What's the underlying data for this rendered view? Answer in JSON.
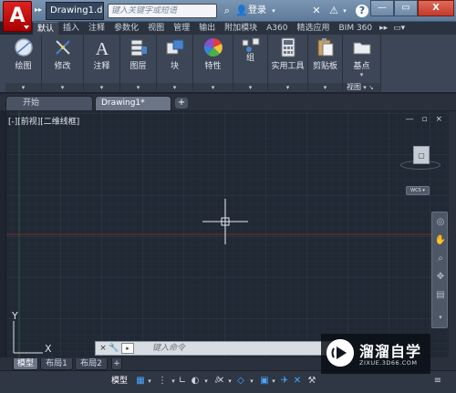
{
  "titlebar": {
    "logo_letter": "A",
    "doc_title": "Drawing1.d...",
    "search_placeholder": "键入关键字或短语",
    "login": "登录",
    "help": "?",
    "minimize": "—",
    "maximize": "▭",
    "close": "X"
  },
  "ribbon_tabs": [
    "默认",
    "插入",
    "注释",
    "参数化",
    "视图",
    "管理",
    "输出",
    "附加模块",
    "A360",
    "精选应用",
    "BIM 360"
  ],
  "ribbon_panels": [
    {
      "label": "绘图",
      "icon": "draw-icon"
    },
    {
      "label": "修改",
      "icon": "modify-icon"
    },
    {
      "label": "注释",
      "icon": "annotation-icon"
    },
    {
      "label": "图层",
      "icon": "layers-icon"
    },
    {
      "label": "块",
      "icon": "block-icon"
    },
    {
      "label": "特性",
      "icon": "properties-icon"
    },
    {
      "label": "组",
      "icon": "group-icon"
    },
    {
      "label": "实用工具",
      "icon": "utilities-icon"
    },
    {
      "label": "剪贴板",
      "icon": "clipboard-icon"
    },
    {
      "label": "基点",
      "icon": "basepoint-icon"
    }
  ],
  "ribbon_view_label": "视图",
  "file_tabs": {
    "start": "开始",
    "drawing": "Drawing1*",
    "add": "+"
  },
  "canvas": {
    "viewport_label": "[-][前视][二维线框]",
    "viewport_controls": "— ▫ ×",
    "ucs_menu": "WCS ▾",
    "y_axis": "Y",
    "x_axis": "X"
  },
  "command_line": {
    "close": "×",
    "wrench": "🔧",
    "prompt": "▸",
    "placeholder": "键入命令"
  },
  "layout_tabs": [
    "模型",
    "布局1",
    "布局2"
  ],
  "layout_add": "+",
  "status_bar": {
    "model_label": "模型"
  },
  "watermark": {
    "title": "溜溜自学",
    "url": "ZIXUE.3D66.COM"
  }
}
